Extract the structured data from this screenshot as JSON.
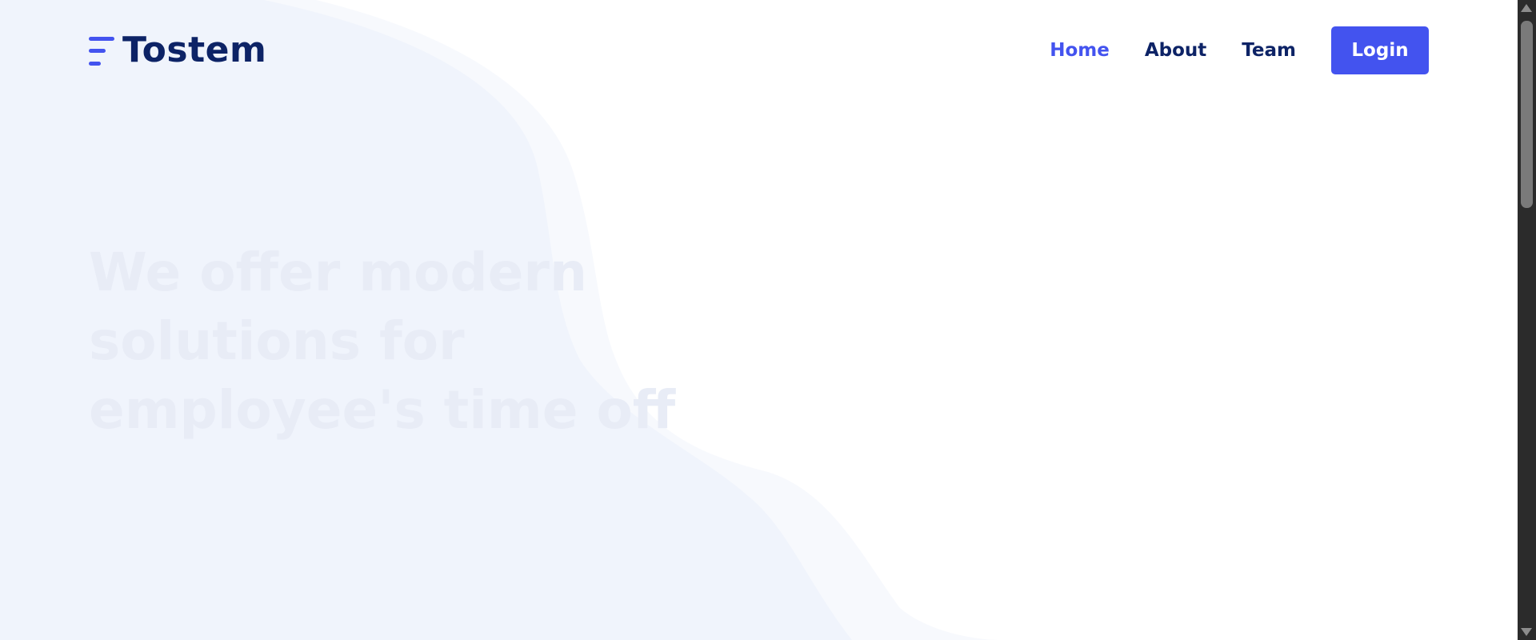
{
  "brand": {
    "name": "Tostem",
    "logo_icon": "bars-logo-icon",
    "accent_color": "#4353ef",
    "text_color": "#0d2366"
  },
  "nav": {
    "links": [
      {
        "label": "Home",
        "active": true
      },
      {
        "label": "About",
        "active": false
      },
      {
        "label": "Team",
        "active": false
      }
    ],
    "login_label": "Login"
  },
  "hero": {
    "title": "We offer modern solutions for employee's time off"
  }
}
